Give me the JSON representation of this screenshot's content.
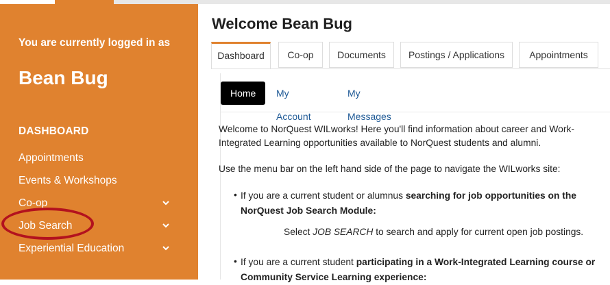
{
  "sidebar": {
    "logged_in_label": "You are currently logged in as",
    "username": "Bean Bug",
    "section_title": "DASHBOARD",
    "items": [
      {
        "label": "Appointments",
        "has_chevron": false
      },
      {
        "label": "Events & Workshops",
        "has_chevron": false
      },
      {
        "label": "Co-op",
        "has_chevron": true
      },
      {
        "label": "Job Search",
        "has_chevron": true
      },
      {
        "label": "Experiential Education",
        "has_chevron": true
      }
    ]
  },
  "main": {
    "title": "Welcome Bean Bug",
    "tabs": [
      {
        "label": "Dashboard",
        "active": true
      },
      {
        "label": "Co-op",
        "active": false
      },
      {
        "label": "Documents",
        "active": false
      },
      {
        "label": "Postings / Applications",
        "active": false
      },
      {
        "label": "Appointments",
        "active": false
      }
    ],
    "subnav": [
      {
        "label": "Home",
        "active": true
      },
      {
        "label": "My Account",
        "active": false
      },
      {
        "label": "My Messages",
        "active": false
      }
    ],
    "content": {
      "intro": "Welcome to NorQuest WILworks! Here you'll find information about career and Work-Integrated Learning opportunities available to NorQuest students and alumni.",
      "nav_hint": "Use the menu bar on the left hand side of the page to navigate the WILworks site:",
      "bullet1_prefix": "If you are a current student or alumnus ",
      "bullet1_bold": "searching for job opportunities on the NorQuest Job Search Module:",
      "bullet1_instr_pre": "Select ",
      "bullet1_instr_em": "JOB SEARCH",
      "bullet1_instr_post": " to search and apply for current open job postings.",
      "bullet2_prefix": "If you are a current student ",
      "bullet2_bold": "participating in a Work-Integrated Learning course or Community Service Learning experience:"
    }
  },
  "colors": {
    "sidebar_bg": "#e0822f",
    "highlight_circle": "#b3121e",
    "link": "#1f5a96"
  }
}
